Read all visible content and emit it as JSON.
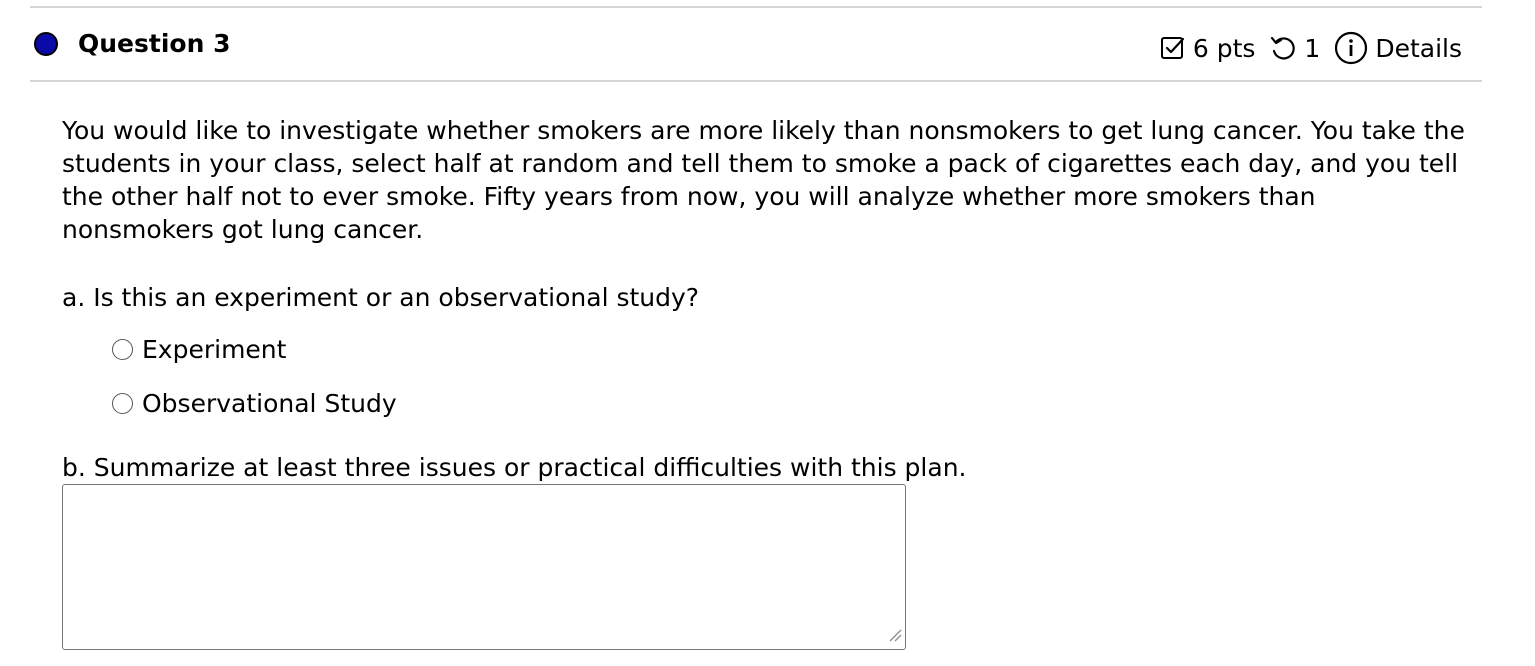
{
  "question": {
    "title": "Question 3",
    "status_color": "#0a0aa8",
    "points": "6 pts",
    "attempts": "1",
    "details_label": "Details",
    "icons": {
      "points": "checkbox-icon",
      "attempts": "retry-icon",
      "details": "info-icon"
    }
  },
  "prompt": "You would like to investigate whether smokers are more likely than nonsmokers to get lung cancer. You take the students in your class, select half at random and tell them to smoke a pack of cigarettes each day, and you tell the other half not to ever smoke. Fifty years from now, you will analyze whether more smokers than nonsmokers got lung cancer.",
  "part_a": {
    "text": "a. Is this an experiment or an observational study?",
    "options": [
      "Experiment",
      "Observational Study"
    ]
  },
  "part_b": {
    "text": "b. Summarize at least three issues or practical difficulties with this plan.",
    "answer_value": ""
  }
}
